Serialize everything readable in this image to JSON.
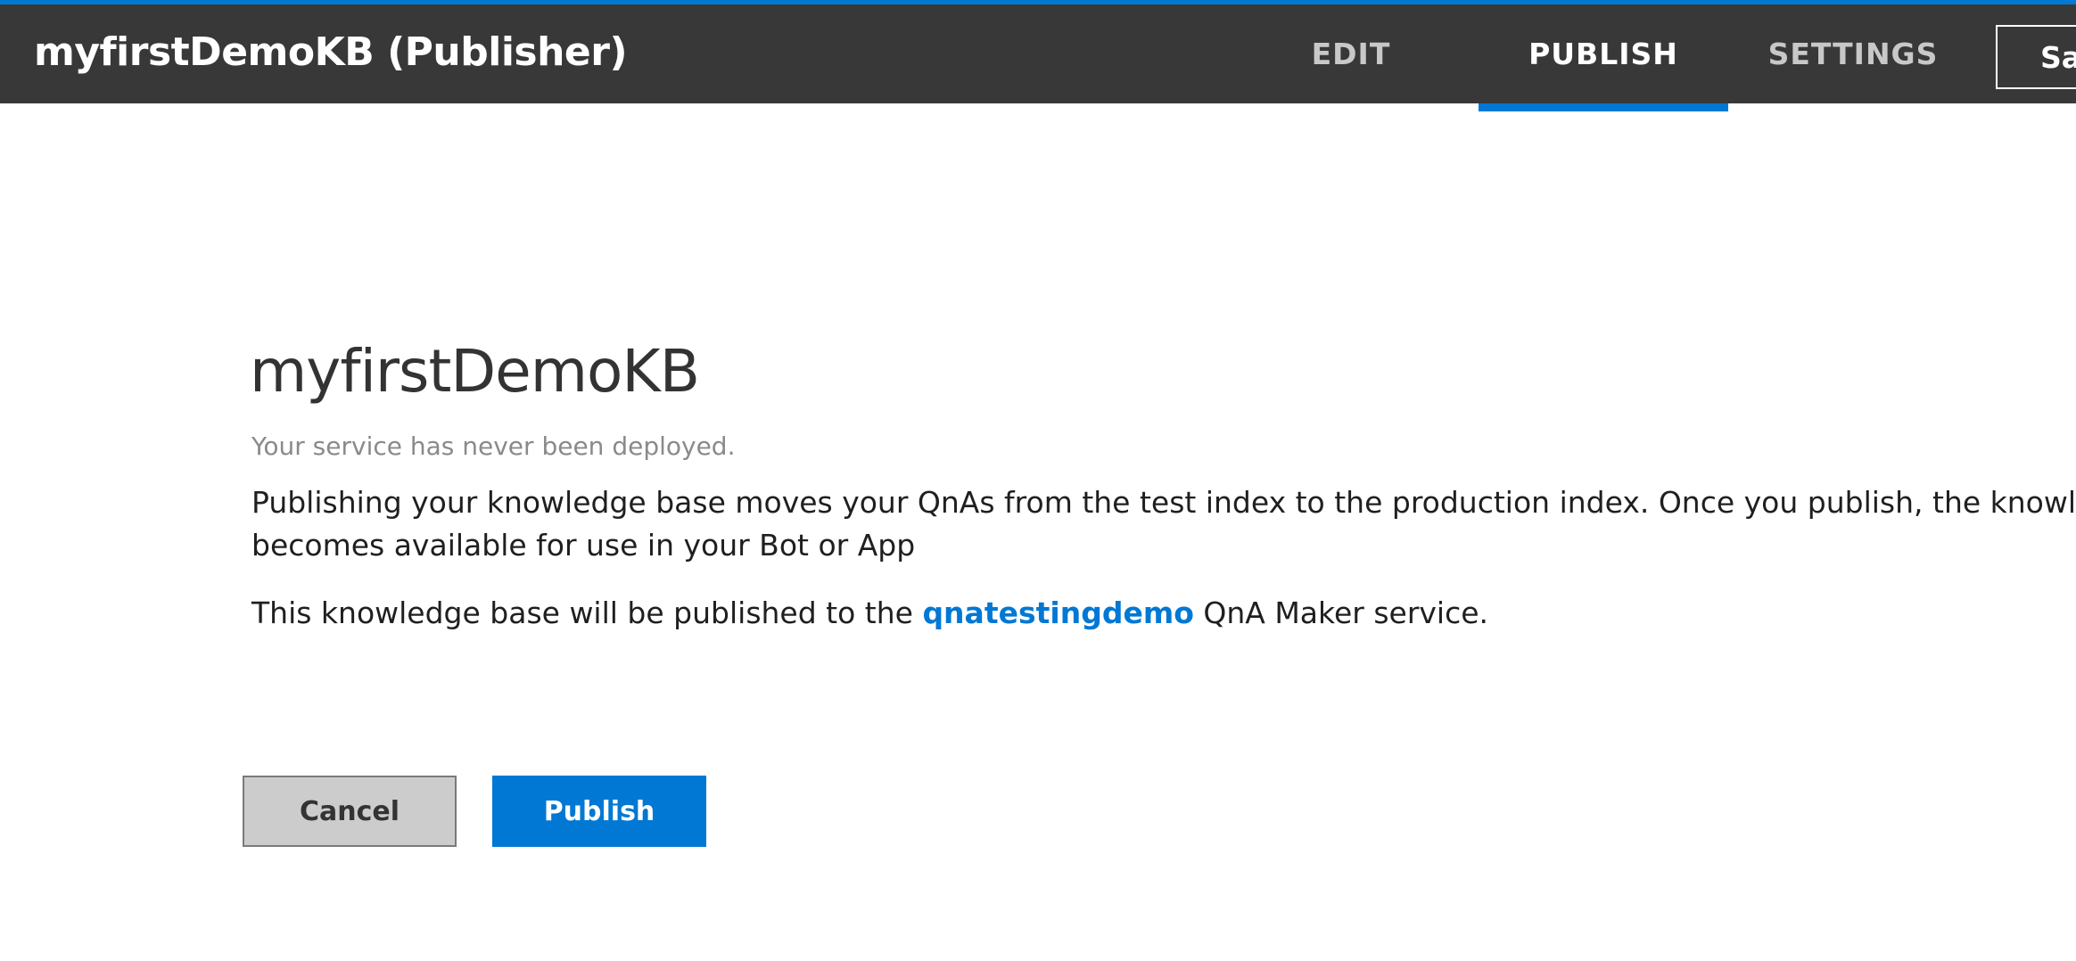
{
  "header": {
    "title": "myfirstDemoKB (Publisher)",
    "tabs": [
      {
        "label": "EDIT",
        "active": false
      },
      {
        "label": "PUBLISH",
        "active": true
      },
      {
        "label": "SETTINGS",
        "active": false
      }
    ],
    "save_label": "Sa",
    "accent_color": "#0078d4",
    "background_color": "#383838"
  },
  "main": {
    "kb_name": "myfirstDemoKB",
    "status_text": "Your service has never been deployed.",
    "description_lines": [
      "Publishing your knowledge base moves your QnAs from the test index to the production index. Once you publish, the knowledge",
      "becomes available for use in your Bot or App"
    ],
    "service_note": {
      "prefix": "This knowledge base will be published to the ",
      "service_name": "qnatestingdemo",
      "suffix": " QnA Maker service."
    }
  },
  "actions": {
    "cancel_label": "Cancel",
    "publish_label": "Publish"
  }
}
